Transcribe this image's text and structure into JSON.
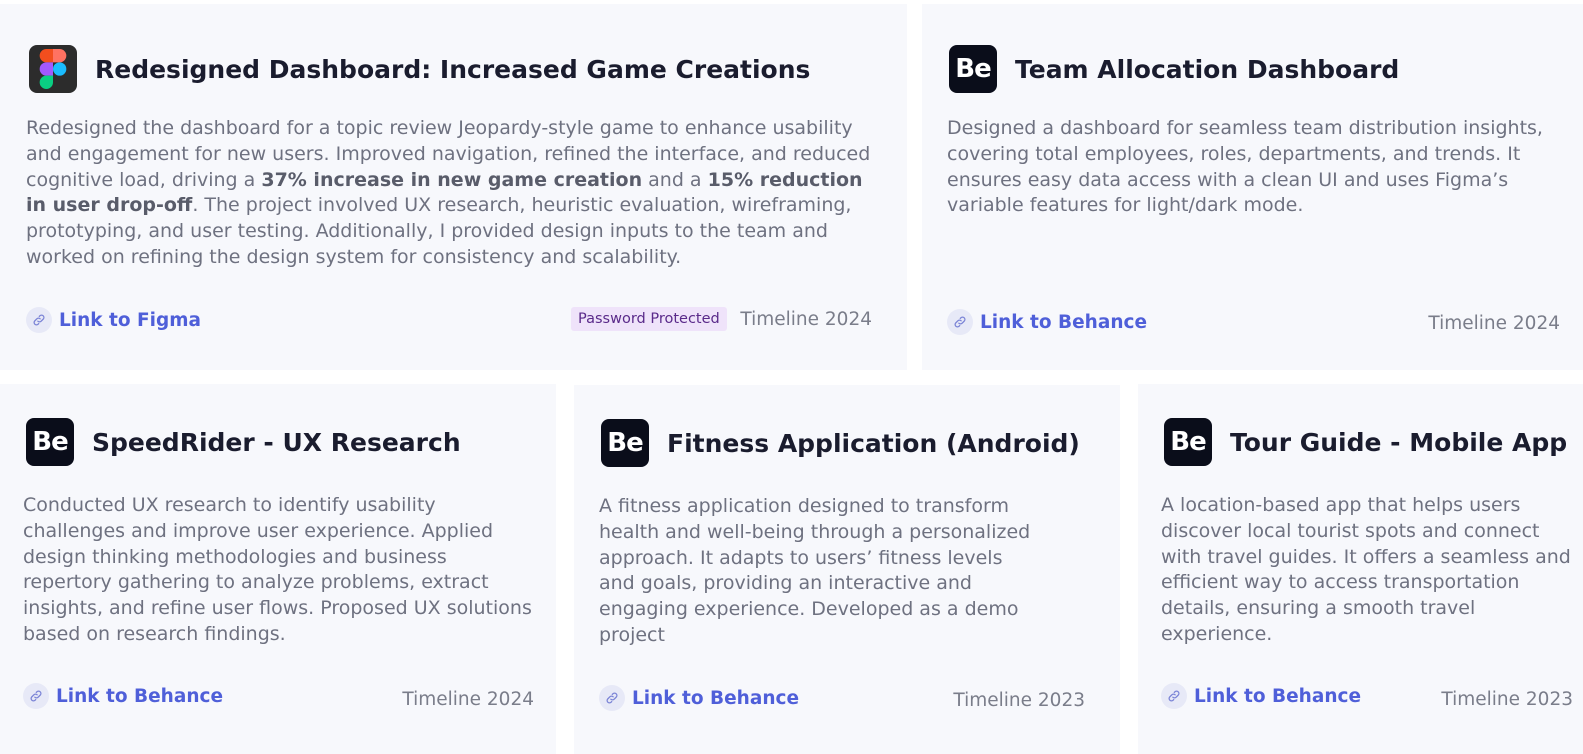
{
  "cards": [
    {
      "title": "Redesigned Dashboard: Increased Game Creations",
      "logo": "figma-icon",
      "desc": {
        "p1": "Redesigned the dashboard for a topic review Jeopardy-style game to enhance usability and engagement for new users. Improved navigation, refined the interface, and reduced cognitive load, driving a ",
        "b1": "37% increase in new game creation",
        "p2": " and a ",
        "b2": "15% reduction in user drop-off",
        "p3": ". The project involved UX research, heuristic evaluation, wireframing, prototyping, and user testing. Additionally, I provided design inputs to the team and worked on refining the design system for consistency and scalability."
      },
      "link": "Link to Figma",
      "badge": "Password Protected",
      "timeline": "Timeline 2024"
    },
    {
      "title": "Team Allocation Dashboard",
      "logo_text": "Be",
      "desc": "Designed a dashboard for seamless team distribution insights, covering total employees, roles, departments, and trends. It ensures easy data access with a clean UI and uses Figma’s variable features for light/dark mode.",
      "link": "Link to Behance",
      "timeline": "Timeline 2024"
    },
    {
      "title": "SpeedRider - UX Research",
      "logo_text": "Be",
      "desc": "Conducted UX research to identify usability challenges and improve user experience. Applied design thinking methodologies and business repertory gathering to analyze problems, extract insights, and refine user flows. Proposed UX solutions based on research findings.",
      "link": "Link to Behance",
      "timeline": "Timeline 2024"
    },
    {
      "title": "Fitness Application (Android)",
      "logo_text": "Be",
      "desc": "A fitness application designed to transform health and well-being through a personalized approach. It adapts to users’ fitness levels and goals, providing an interactive and engaging experience. Developed as a demo project",
      "link": "Link to Behance",
      "timeline": "Timeline 2023"
    },
    {
      "title": "Tour Guide - Mobile App",
      "logo_text": "Be",
      "desc": "A location-based app that helps users discover local tourist spots and connect with travel guides. It offers a seamless and efficient way to access transportation details, ensuring a smooth travel experience.",
      "link": "Link to Behance",
      "timeline": "Timeline 2023"
    }
  ],
  "colors": {
    "card_bg": "#f7f8fc",
    "link": "#4f5fd9",
    "badge_bg": "#efe3fa",
    "badge_text": "#5a2a8a",
    "behance_bg": "#0a0d1a"
  }
}
